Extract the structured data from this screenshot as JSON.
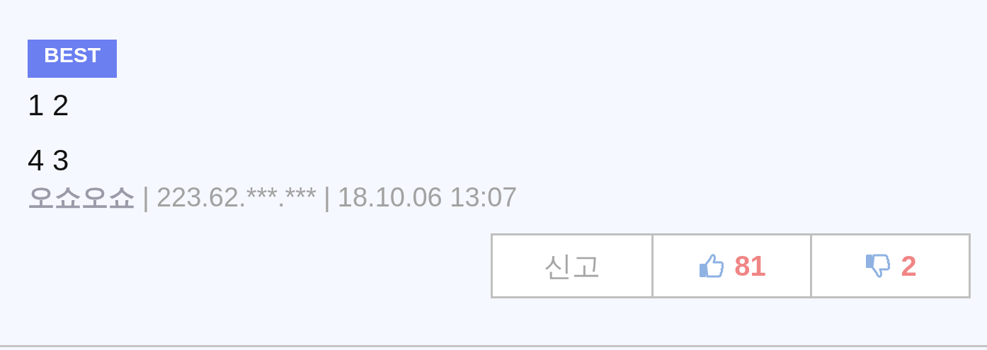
{
  "comment": {
    "badge": "BEST",
    "lines": [
      "1 2",
      "4 3"
    ],
    "meta": [
      {
        "kind": "author",
        "text": "오쇼오쇼"
      },
      {
        "kind": "separator",
        "text": "|"
      },
      {
        "kind": "text",
        "text": "223.62.***.***"
      },
      {
        "kind": "separator",
        "text": "|"
      },
      {
        "kind": "text",
        "text": "18.10.06 13:07"
      }
    ],
    "actions": [
      {
        "kind": "report",
        "label": "신고"
      },
      {
        "kind": "like",
        "label": "81"
      },
      {
        "kind": "dislike",
        "label": "2"
      }
    ]
  }
}
